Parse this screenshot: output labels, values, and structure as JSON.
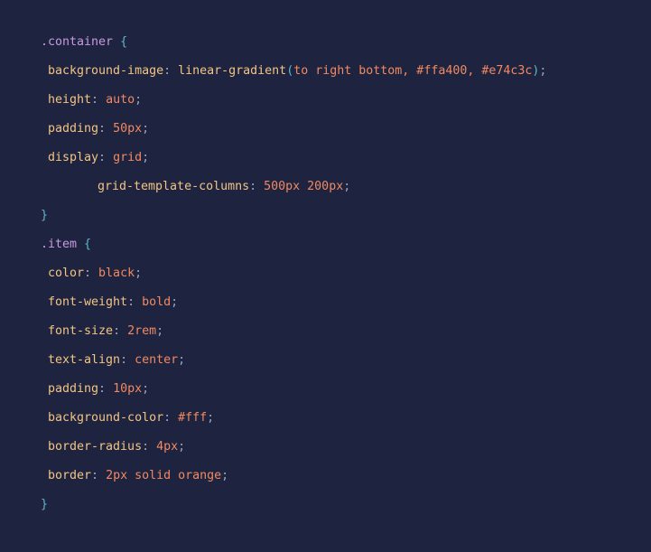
{
  "editor": {
    "theme": {
      "background": "#1e2340",
      "selector": "#c99ae0",
      "brace": "#5fb6c8",
      "property": "#f2c584",
      "value": "#f08a62",
      "punctuation": "#9aa5c0"
    },
    "lines": [
      {
        "selector": ".container",
        "open": "{"
      },
      {
        "prop": "background-image",
        "fn": "linear-gradient",
        "args": "to right bottom, #ffa400, #e74c3c"
      },
      {
        "prop": "height",
        "value": "auto"
      },
      {
        "prop": "padding",
        "value": "50px"
      },
      {
        "prop": "display",
        "value": "grid"
      },
      {
        "prop": "grid-template-columns",
        "value": "500px 200px"
      },
      {
        "close": "}"
      },
      {
        "selector": ".item",
        "open": "{"
      },
      {
        "prop": "color",
        "value": "black"
      },
      {
        "prop": "font-weight",
        "value": "bold"
      },
      {
        "prop": "font-size",
        "value": "2rem"
      },
      {
        "prop": "text-align",
        "value": "center"
      },
      {
        "prop": "padding",
        "value": "10px"
      },
      {
        "prop": "background-color",
        "value": "#fff"
      },
      {
        "prop": "border-radius",
        "value": "4px"
      },
      {
        "prop": "border",
        "value": "2px solid orange"
      },
      {
        "close": "}"
      }
    ]
  }
}
